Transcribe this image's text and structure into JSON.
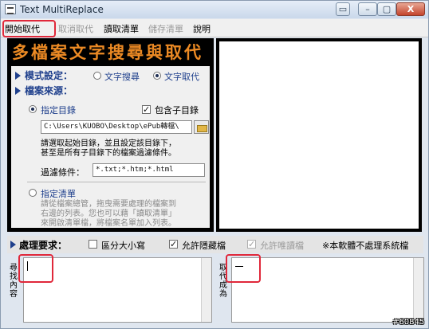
{
  "window": {
    "title": "Text MultiReplace",
    "controls": {
      "minimize": "▭",
      "maximize": "▢",
      "close": "X"
    }
  },
  "menu": [
    {
      "label": "開始取代",
      "enabled": true
    },
    {
      "label": "取消取代",
      "enabled": false
    },
    {
      "label": "讀取清單",
      "enabled": true
    },
    {
      "label": "儲存清單",
      "enabled": false
    },
    {
      "label": "說明",
      "enabled": true
    }
  ],
  "banner": "多檔案文字搜尋與取代",
  "mode": {
    "label": "模式設定：",
    "options": [
      "文字搜尋",
      "文字取代"
    ],
    "selected": "文字取代"
  },
  "source": {
    "label": "檔案來源：",
    "directory_option": "指定目錄",
    "include_subdirs_label": "包含子目錄",
    "include_subdirs_checked": true,
    "path_value": "C:\\Users\\KUOBO\\Desktop\\ePub轉檔\\",
    "directory_desc": [
      "請選取起始目錄，並且設定該目錄下，",
      "甚至是所有子目錄下的檔案過濾條件。"
    ],
    "filter_label": "過濾條件：",
    "filter_value": "*.txt;*.htm;*.html",
    "list_option": "指定清單",
    "list_desc": [
      "請從檔案總管，拖曳需要處理的檔案到",
      "右邊的列表。您也可以藉「讀取清單」",
      "來開啟清單檔，將檔案名單加入列表。"
    ],
    "selected": "指定目錄"
  },
  "processing": {
    "label": "處理要求：",
    "case_sensitive_label": "區分大小寫",
    "case_sensitive_checked": false,
    "allow_hidden_label": "允許隱藏檔",
    "allow_hidden_checked": true,
    "allow_readonly_label": "允許唯讀檔",
    "allow_readonly_checked": true,
    "note": "※本軟體不處理系統檔"
  },
  "search_area": {
    "label": "尋找內容",
    "value": ""
  },
  "replace_area": {
    "label": "取代成為",
    "value": ""
  },
  "watermark": "#60845",
  "colors": {
    "banner": "#ec8a24",
    "highlight_box": "#e0283a",
    "label_blue": "#1e3f8c"
  }
}
